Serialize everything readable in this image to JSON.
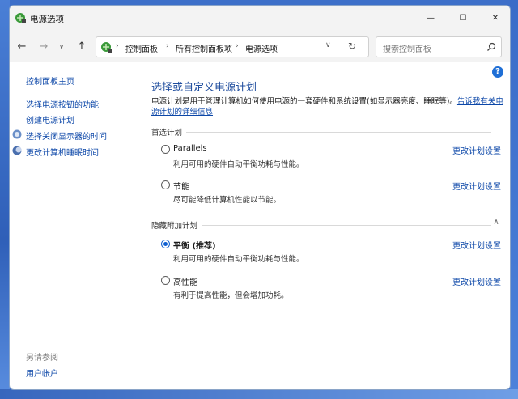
{
  "window": {
    "title": "电源选项",
    "minimize_glyph": "—",
    "maximize_glyph": "☐",
    "close_glyph": "✕"
  },
  "nav": {
    "back_glyph": "←",
    "forward_glyph": "→",
    "recent_glyph": "∨",
    "up_glyph": "↑"
  },
  "address": {
    "sep": "›",
    "crumbs": [
      "控制面板",
      "所有控制面板项",
      "电源选项"
    ],
    "dropdown_glyph": "∨",
    "refresh_glyph": "↻"
  },
  "search": {
    "placeholder": "搜索控制面板",
    "icon": "search-icon"
  },
  "sidebar": {
    "home": "控制面板主页",
    "items": [
      "选择电源按钮的功能",
      "创建电源计划",
      "选择关闭显示器的时间",
      "更改计算机睡眠时间"
    ],
    "see_also_label": "另请参阅",
    "user_accounts": "用户帐户"
  },
  "main": {
    "title": "选择或自定义电源计划",
    "description": "电源计划是用于管理计算机如何使用电源的一套硬件和系统设置(如显示器亮度、睡眠等)。",
    "description_link": "告诉我有关电源计划的详细信息",
    "help_glyph": "?",
    "preferred_section": "首选计划",
    "hidden_section": "隐藏附加计划",
    "hidden_toggle": "∧",
    "change_link": "更改计划设置",
    "plans": [
      {
        "name": "Parallels",
        "desc": "利用可用的硬件自动平衡功耗与性能。",
        "selected": false
      },
      {
        "name": "节能",
        "desc": "尽可能降低计算机性能以节能。",
        "selected": false
      },
      {
        "name": "平衡 (推荐)",
        "desc": "利用可用的硬件自动平衡功耗与性能。",
        "selected": true
      },
      {
        "name": "高性能",
        "desc": "有利于提高性能，但会增加功耗。",
        "selected": false
      }
    ]
  },
  "colors": {
    "link": "#0c47a8",
    "title_blue": "#1f4d9e",
    "radio_selected": "#0e5fd0"
  }
}
